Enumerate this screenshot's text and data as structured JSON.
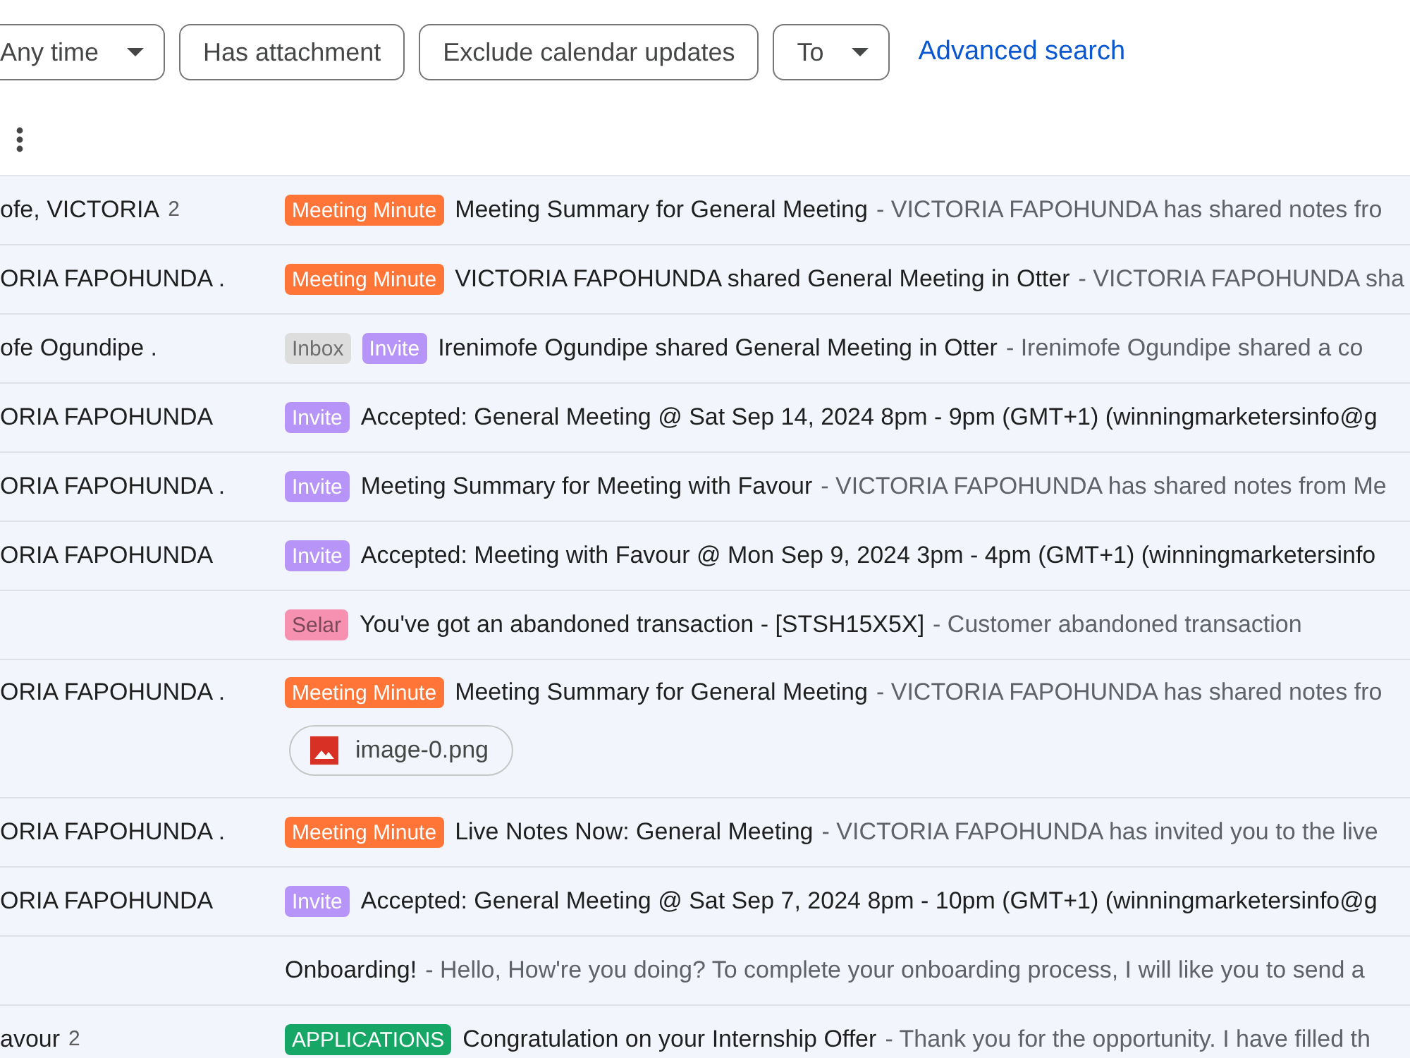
{
  "filters": [
    {
      "label": "Any time",
      "kind": "dropdown"
    },
    {
      "label": "Has attachment",
      "kind": "toggle"
    },
    {
      "label": "Exclude calendar updates",
      "kind": "toggle"
    },
    {
      "label": "To",
      "kind": "dropdown"
    }
  ],
  "advanced_search": "Advanced search",
  "messages": [
    {
      "sender": "ofe, VICTORIA",
      "count": "2",
      "labels": [
        {
          "text": "Meeting Minute",
          "color": "#ff7537"
        }
      ],
      "subject": "Meeting Summary for General Meeting",
      "snippet": "- VICTORIA FAPOHUNDA has shared notes fro"
    },
    {
      "sender": "ORIA FAPOHUNDA .",
      "labels": [
        {
          "text": "Meeting Minute",
          "color": "#ff7537"
        }
      ],
      "subject": "VICTORIA FAPOHUNDA shared General Meeting in Otter",
      "snippet": "- VICTORIA FAPOHUNDA sha"
    },
    {
      "sender": "ofe Ogundipe .",
      "labels": [
        {
          "text": "Inbox",
          "color": "#dddddd"
        },
        {
          "text": "Invite",
          "color": "#b694f8"
        }
      ],
      "subject": "Irenimofe Ogundipe shared General Meeting in Otter",
      "snippet": "- Irenimofe Ogundipe shared a co"
    },
    {
      "sender": "ORIA FAPOHUNDA",
      "labels": [
        {
          "text": "Invite",
          "color": "#b694f8"
        }
      ],
      "subject": "Accepted: General Meeting @ Sat Sep 14, 2024 8pm - 9pm (GMT+1) (winningmarketersinfo@g"
    },
    {
      "sender": "ORIA FAPOHUNDA .",
      "labels": [
        {
          "text": "Invite",
          "color": "#b694f8"
        }
      ],
      "subject": "Meeting Summary for Meeting with Favour",
      "snippet": "- VICTORIA FAPOHUNDA has shared notes from Me"
    },
    {
      "sender": "ORIA FAPOHUNDA",
      "labels": [
        {
          "text": "Invite",
          "color": "#b694f8"
        }
      ],
      "subject": "Accepted: Meeting with Favour @ Mon Sep 9, 2024 3pm - 4pm (GMT+1) (winningmarketersinfo"
    },
    {
      "labels": [
        {
          "text": "Selar",
          "color": "#f691b2"
        }
      ],
      "subject": "You've got an abandoned transaction - [STSH15X5X]",
      "snippet": "- Customer abandoned transaction"
    },
    {
      "sender": "ORIA FAPOHUNDA .",
      "labels": [
        {
          "text": "Meeting Minute",
          "color": "#ff7537"
        }
      ],
      "subject": "Meeting Summary for General Meeting",
      "snippet": "- VICTORIA FAPOHUNDA has shared notes fro",
      "attachments": [
        "image-0.png"
      ]
    },
    {
      "sender": "ORIA FAPOHUNDA .",
      "labels": [
        {
          "text": "Meeting Minute",
          "color": "#ff7537"
        }
      ],
      "subject": "Live Notes Now: General Meeting",
      "snippet": "- VICTORIA FAPOHUNDA has invited you to the live"
    },
    {
      "sender": "ORIA FAPOHUNDA",
      "labels": [
        {
          "text": "Invite",
          "color": "#b694f8"
        }
      ],
      "subject": "Accepted: General Meeting @ Sat Sep 7, 2024 8pm - 10pm (GMT+1) (winningmarketersinfo@g"
    },
    {
      "subject": "Onboarding!",
      "snippet": "- Hello, How're you doing? To complete your onboarding process, I will like you to send a"
    },
    {
      "sender": "avour",
      "count": "2",
      "labels": [
        {
          "text": "APPLICATIONS",
          "color": "#16a766"
        }
      ],
      "subject": "Congratulation on your Internship Offer",
      "snippet": "- Thank you for the opportunity. I have filled th"
    }
  ]
}
